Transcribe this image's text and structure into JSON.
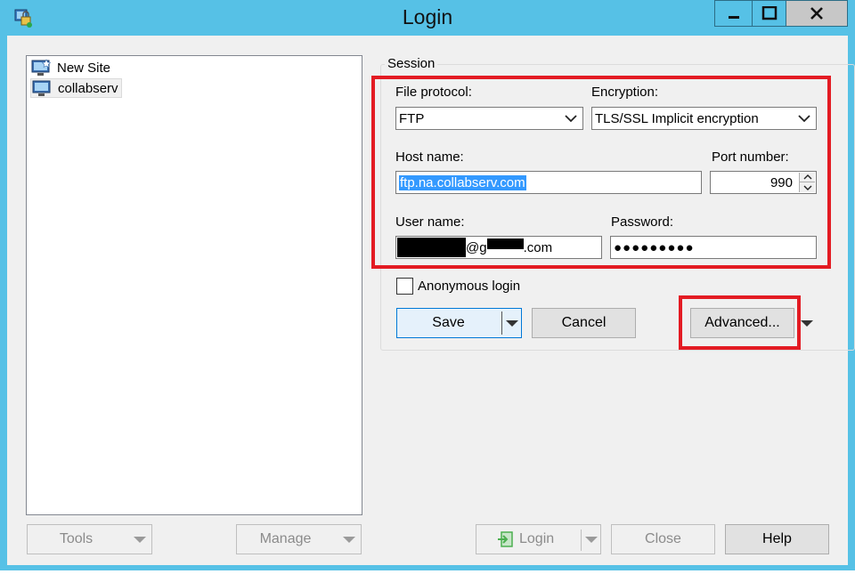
{
  "window": {
    "title": "Login"
  },
  "sites": [
    {
      "label": "New Site"
    },
    {
      "label": "collabserv"
    }
  ],
  "session": {
    "group_label": "Session",
    "file_protocol_label": "File protocol:",
    "file_protocol_value": "FTP",
    "encryption_label": "Encryption:",
    "encryption_value": "TLS/SSL Implicit encryption",
    "host_name_label": "Host name:",
    "host_name_value": "ftp.na.collabserv.com",
    "port_label": "Port number:",
    "port_value": "990",
    "user_name_label": "User name:",
    "user_name_visible_at": "@g",
    "user_name_visible_tail": ".com",
    "password_label": "Password:",
    "password_value": "●●●●●●●●●",
    "anonymous_label": "Anonymous login"
  },
  "buttons": {
    "save": "Save",
    "cancel": "Cancel",
    "advanced": "Advanced...",
    "tools": "Tools",
    "manage": "Manage",
    "login": "Login",
    "close": "Close",
    "help": "Help"
  },
  "colors": {
    "title_bar": "#56c1e6",
    "highlight": "#e31b23",
    "selection": "#3399ff"
  },
  "icons": {
    "app": "winscp-icon",
    "site": "computer-icon",
    "login": "login-icon"
  }
}
